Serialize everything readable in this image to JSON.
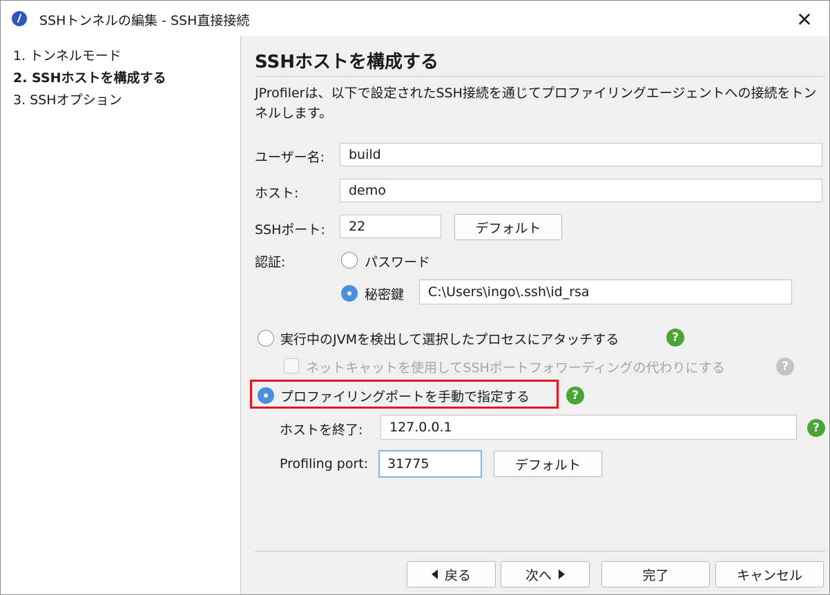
{
  "window": {
    "title": "SSHトンネルの編集 - SSH直接接続",
    "close_glyph": "✕"
  },
  "steps": [
    {
      "label": "1. トンネルモード"
    },
    {
      "label": "2. SSHホストを構成する"
    },
    {
      "label": "3. SSHオプション"
    }
  ],
  "main": {
    "title": "SSHホストを構成する",
    "description": "JProfilerは、以下で設定されたSSH接続を通じてプロファイリングエージェントへの接続をトンネルします。",
    "username": {
      "label": "ユーザー名:",
      "value": "build"
    },
    "host": {
      "label": "ホスト:",
      "value": "demo"
    },
    "ssh_port": {
      "label": "SSHポート:",
      "value": "22",
      "default_label": "デフォルト"
    },
    "auth": {
      "label": "認証:",
      "password_label": "パスワード",
      "private_key_label": "秘密鍵",
      "private_key_path": "C:\\Users\\ingo\\.ssh\\id_rsa",
      "selected": "private_key"
    },
    "attach_option": {
      "label": "実行中のJVMを検出して選択したプロセスにアタッチする",
      "checked": false
    },
    "netcat_option": {
      "label": "ネットキャットを使用してSSHポートフォワーディングの代わりにする",
      "checked": false,
      "enabled": false
    },
    "manual_option": {
      "label": "プロファイリングポートを手動で指定する",
      "checked": true
    },
    "end_host": {
      "label": "ホストを終了:",
      "value": "127.0.0.1"
    },
    "profiling_port": {
      "label": "Profiling port:",
      "value": "31775",
      "default_label": "デフォルト"
    },
    "help_glyph": "?"
  },
  "footer": {
    "back_label": "戻る",
    "next_label": "次へ",
    "finish_label": "完了",
    "cancel_label": "キャンセル"
  },
  "colors": {
    "accent": "#4a90dd",
    "help": "#4aa634",
    "highlight": "#e8141c"
  }
}
